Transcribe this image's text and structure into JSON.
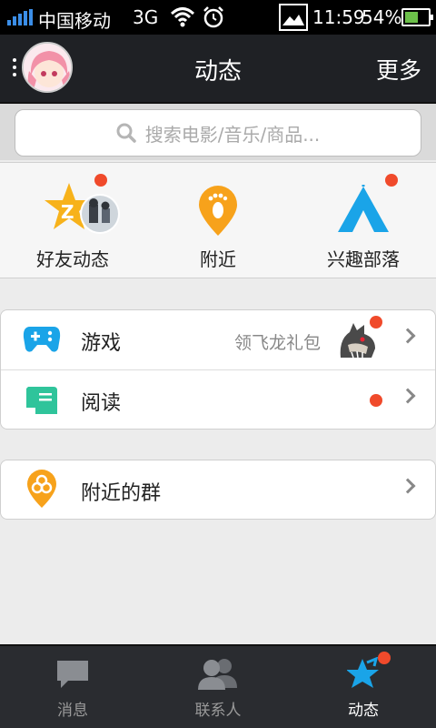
{
  "status_bar": {
    "carrier": "中国移动",
    "network": "3G",
    "time": "11:59",
    "battery_percent": "54%",
    "battery_level": 0.54,
    "signal_color": "#3b8ee8"
  },
  "header": {
    "title": "动态",
    "more_label": "更多"
  },
  "search": {
    "placeholder": "搜索电影/音乐/商品..."
  },
  "quick_actions": [
    {
      "label": "好友动态",
      "icon": "qzone-star-icon",
      "has_badge": true
    },
    {
      "label": "附近",
      "icon": "footprint-pin-icon",
      "has_badge": false
    },
    {
      "label": "兴趣部落",
      "icon": "tent-icon",
      "has_badge": true
    }
  ],
  "list_group_1": [
    {
      "label": "游戏",
      "sub": "领飞龙礼包",
      "icon": "gamepad-icon"
    },
    {
      "label": "阅读",
      "icon": "book-icon",
      "has_badge": true
    }
  ],
  "list_group_2": [
    {
      "label": "附近的群",
      "icon": "group-pin-icon"
    }
  ],
  "tabs": [
    {
      "label": "消息",
      "icon": "chat-bubble-icon",
      "active": false
    },
    {
      "label": "联系人",
      "icon": "contacts-icon",
      "active": false
    },
    {
      "label": "动态",
      "icon": "star-tab-icon",
      "active": true
    }
  ],
  "colors": {
    "accent_blue": "#1aa4e8",
    "accent_orange": "#f7a21b",
    "badge_red": "#f04a2b",
    "header_bg": "#1f2125"
  }
}
